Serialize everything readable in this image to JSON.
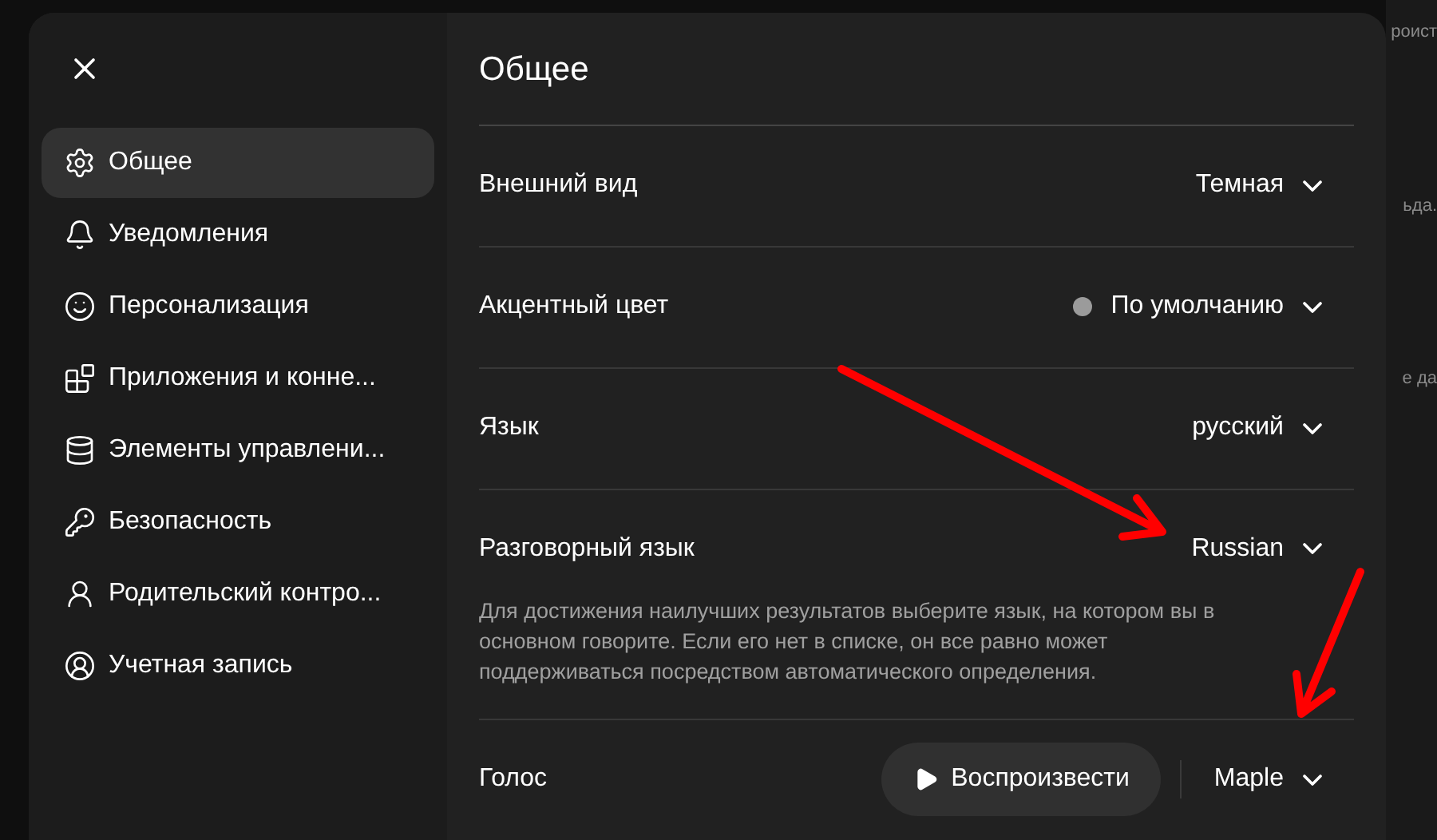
{
  "background_fragments": [
    "роист",
    "ьда.",
    "е да"
  ],
  "sidebar": {
    "items": [
      {
        "label": "Общее",
        "selected": true
      },
      {
        "label": "Уведомления",
        "selected": false
      },
      {
        "label": "Персонализация",
        "selected": false
      },
      {
        "label": "Приложения и конне...",
        "selected": false
      },
      {
        "label": "Элементы управлени...",
        "selected": false
      },
      {
        "label": "Безопасность",
        "selected": false
      },
      {
        "label": "Родительский контро...",
        "selected": false
      },
      {
        "label": "Учетная запись",
        "selected": false
      }
    ]
  },
  "page": {
    "title": "Общее",
    "rows": [
      {
        "kind": "dropdown",
        "label": "Внешний вид",
        "value": "Темная"
      },
      {
        "kind": "dot_dropdown",
        "label": "Акцентный цвет",
        "value": "По умолчанию",
        "color": "#9b9b9b"
      },
      {
        "kind": "dropdown",
        "label": "Язык",
        "value": "русский"
      },
      {
        "kind": "dropdown",
        "label": "Разговорный язык",
        "value": "Russian",
        "description": "Для достижения наилучших результатов выберите язык, на котором вы в основном говорите. Если его нет в списке, он все равно может поддерживаться посредством автоматического определения."
      },
      {
        "kind": "voice",
        "label": "Голос",
        "button": "Воспроизвести",
        "value": "Maple"
      }
    ]
  }
}
